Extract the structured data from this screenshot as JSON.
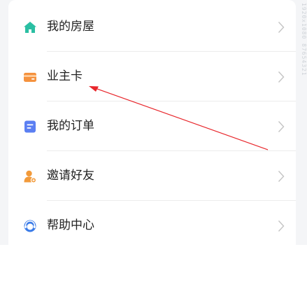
{
  "menu": {
    "items": [
      {
        "label": "我的房屋",
        "icon": "home-icon",
        "color": "#2bbfa3"
      },
      {
        "label": "业主卡",
        "icon": "card-icon",
        "color": "#f5923e"
      },
      {
        "label": "我的订单",
        "icon": "order-icon",
        "color": "#5b7ff2"
      },
      {
        "label": "邀请好友",
        "icon": "invite-friend-icon",
        "color": "#f29a3a"
      },
      {
        "label": "帮助中心",
        "icon": "help-center-icon",
        "color": "#3a7be8"
      }
    ]
  },
  "watermark": {
    "text": "1920x1080  87654321"
  },
  "annotation": {
    "color": "#e8262b"
  }
}
